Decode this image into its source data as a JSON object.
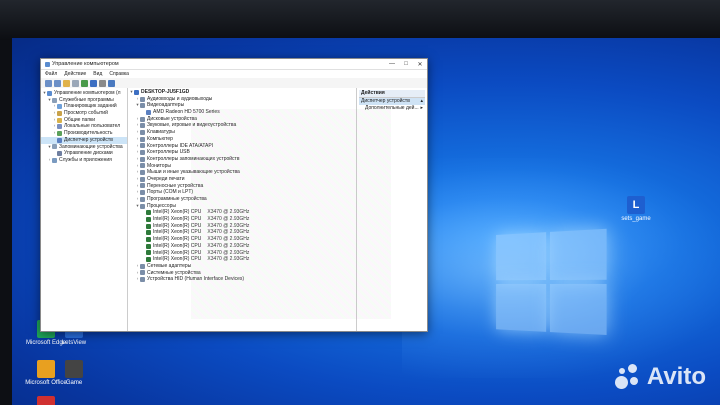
{
  "window": {
    "title": "Управление компьютером",
    "controls": {
      "minimize": "—",
      "maximize": "□",
      "close": "✕"
    }
  },
  "menu": [
    "Файл",
    "Действие",
    "Вид",
    "Справка"
  ],
  "left_tree": [
    {
      "label": "Управление компьютером (л",
      "indent": 0,
      "arrow": "▾",
      "selected": false
    },
    {
      "label": "Служебные программы",
      "indent": 1,
      "arrow": "▾",
      "selected": false
    },
    {
      "label": "Планировщик заданий",
      "indent": 2,
      "arrow": "›",
      "selected": false
    },
    {
      "label": "Просмотр событий",
      "indent": 2,
      "arrow": "›",
      "selected": false
    },
    {
      "label": "Общие папки",
      "indent": 2,
      "arrow": "›",
      "selected": false
    },
    {
      "label": "Локальные пользовател",
      "indent": 2,
      "arrow": "›",
      "selected": false
    },
    {
      "label": "Производительность",
      "indent": 2,
      "arrow": "›",
      "selected": false
    },
    {
      "label": "Диспетчер устройств",
      "indent": 2,
      "arrow": "",
      "selected": true
    },
    {
      "label": "Запоминающие устройства",
      "indent": 1,
      "arrow": "▾",
      "selected": false
    },
    {
      "label": "Управление дисками",
      "indent": 2,
      "arrow": "",
      "selected": false
    },
    {
      "label": "Службы и приложения",
      "indent": 1,
      "arrow": "›",
      "selected": false
    }
  ],
  "device_tree": [
    {
      "label": "DESKTOP-JU5F1GD",
      "indent": 0,
      "arrow": "▾",
      "value": ""
    },
    {
      "label": "Аудиовходы и аудиовыходы",
      "indent": 1,
      "arrow": "›",
      "value": ""
    },
    {
      "label": "Видеоадаптеры",
      "indent": 1,
      "arrow": "▾",
      "value": ""
    },
    {
      "label": "AMD Radeon HD 5700 Series",
      "indent": 2,
      "arrow": "",
      "value": ""
    },
    {
      "label": "Дисковые устройства",
      "indent": 1,
      "arrow": "›",
      "value": ""
    },
    {
      "label": "Звуковые, игровые и видеоустройства",
      "indent": 1,
      "arrow": "›",
      "value": ""
    },
    {
      "label": "Клавиатуры",
      "indent": 1,
      "arrow": "›",
      "value": ""
    },
    {
      "label": "Компьютер",
      "indent": 1,
      "arrow": "›",
      "value": ""
    },
    {
      "label": "Контроллеры IDE ATA/ATAPI",
      "indent": 1,
      "arrow": "›",
      "value": ""
    },
    {
      "label": "Контроллеры USB",
      "indent": 1,
      "arrow": "›",
      "value": ""
    },
    {
      "label": "Контроллеры запоминающих устройств",
      "indent": 1,
      "arrow": "›",
      "value": ""
    },
    {
      "label": "Мониторы",
      "indent": 1,
      "arrow": "›",
      "value": ""
    },
    {
      "label": "Мыши и иные указывающие устройства",
      "indent": 1,
      "arrow": "›",
      "value": ""
    },
    {
      "label": "Очереди печати",
      "indent": 1,
      "arrow": "›",
      "value": ""
    },
    {
      "label": "Переносные устройства",
      "indent": 1,
      "arrow": "›",
      "value": ""
    },
    {
      "label": "Порты (COM и LPT)",
      "indent": 1,
      "arrow": "›",
      "value": ""
    },
    {
      "label": "Программные устройства",
      "indent": 1,
      "arrow": "›",
      "value": ""
    },
    {
      "label": "Процессоры",
      "indent": 1,
      "arrow": "▾",
      "value": ""
    },
    {
      "label": "Intel(R) Xeon(R) CPU",
      "indent": 2,
      "arrow": "",
      "value": "X3470  @ 2.93GHz"
    },
    {
      "label": "Intel(R) Xeon(R) CPU",
      "indent": 2,
      "arrow": "",
      "value": "X3470  @ 2.93GHz"
    },
    {
      "label": "Intel(R) Xeon(R) CPU",
      "indent": 2,
      "arrow": "",
      "value": "X3470  @ 2.93GHz"
    },
    {
      "label": "Intel(R) Xeon(R) CPU",
      "indent": 2,
      "arrow": "",
      "value": "X3470  @ 2.93GHz"
    },
    {
      "label": "Intel(R) Xeon(R) CPU",
      "indent": 2,
      "arrow": "",
      "value": "X3470  @ 2.93GHz"
    },
    {
      "label": "Intel(R) Xeon(R) CPU",
      "indent": 2,
      "arrow": "",
      "value": "X3470  @ 2.93GHz"
    },
    {
      "label": "Intel(R) Xeon(R) CPU",
      "indent": 2,
      "arrow": "",
      "value": "X3470  @ 2.93GHz"
    },
    {
      "label": "Intel(R) Xeon(R) CPU",
      "indent": 2,
      "arrow": "",
      "value": "X3470  @ 2.93GHz"
    },
    {
      "label": "Сетевые адаптеры",
      "indent": 1,
      "arrow": "›",
      "value": ""
    },
    {
      "label": "Системные устройства",
      "indent": 1,
      "arrow": "›",
      "value": ""
    },
    {
      "label": "Устройства HID (Human Interface Devices)",
      "indent": 1,
      "arrow": "›",
      "value": ""
    }
  ],
  "actions": {
    "header": "Действия",
    "selected": "Диспетчер устройств",
    "selected_arrow": "▴",
    "more": "Дополнительные дей...",
    "more_arrow": "▸"
  },
  "desktop_icons": [
    {
      "label": "Microsoft Edge",
      "color": "#1fa85a"
    },
    {
      "label": "LetsView",
      "color": "#2a6fe0"
    },
    {
      "label": "Microsoft Office",
      "color": "#e8a020"
    },
    {
      "label": "Game",
      "color": "#444444"
    },
    {
      "label": "",
      "color": "#d03030"
    }
  ],
  "desktop_right_icon": {
    "label": "sets_game",
    "letter": "L"
  },
  "watermark": "Avito"
}
